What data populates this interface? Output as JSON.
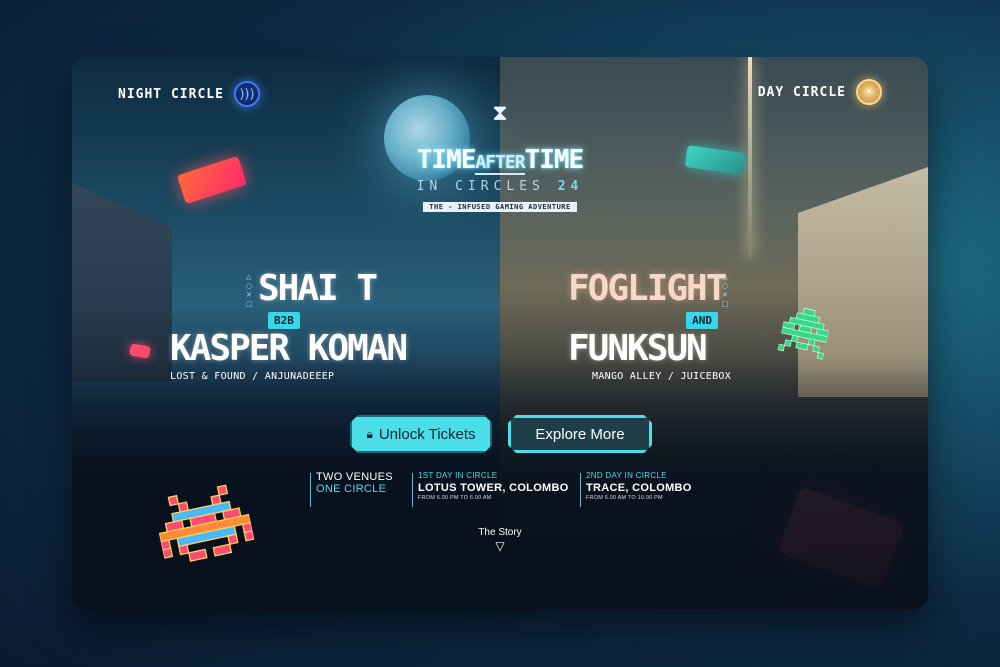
{
  "header": {
    "night_label": "NIGHT CIRCLE",
    "day_label": "DAY CIRCLE",
    "night_icon": "moon-signal-icon",
    "day_icon": "sun-icon"
  },
  "hero": {
    "title_left": "TIME",
    "title_mid": "AFTER",
    "title_right": "TIME",
    "subtitle": "IN CIRCLES",
    "subtitle_num": "24",
    "tagline": "THE - INFUSED GAMING ADVENTURE"
  },
  "lineup_left": {
    "artist1": "SHAI T",
    "connector": "B2B",
    "artist2": "KASPER KOMAN",
    "labels": "LOST & FOUND / ANJUNADEEEP"
  },
  "lineup_right": {
    "artist1": "FOGLIGHT",
    "connector": "AND",
    "artist2": "FUNKSUN",
    "labels": "MANGO ALLEY / JUICEBOX"
  },
  "buttons": {
    "unlock": "Unlock Tickets",
    "explore": "Explore More"
  },
  "info": {
    "venues_a": "TWO VENUES",
    "venues_b": "ONE CIRCLE",
    "day1_label": "1ST DAY IN CIRCLE",
    "day1_venue": "LOTUS TOWER, COLOMBO",
    "day1_time": "FROM 6.00 PM TO 6.00 AM",
    "day2_label": "2ND DAY IN CIRCLE",
    "day2_venue": "TRACE, COLOMBO",
    "day2_time": "FROM 6.00 AM TO 10.00 PM"
  },
  "story": {
    "label": "The Story"
  }
}
